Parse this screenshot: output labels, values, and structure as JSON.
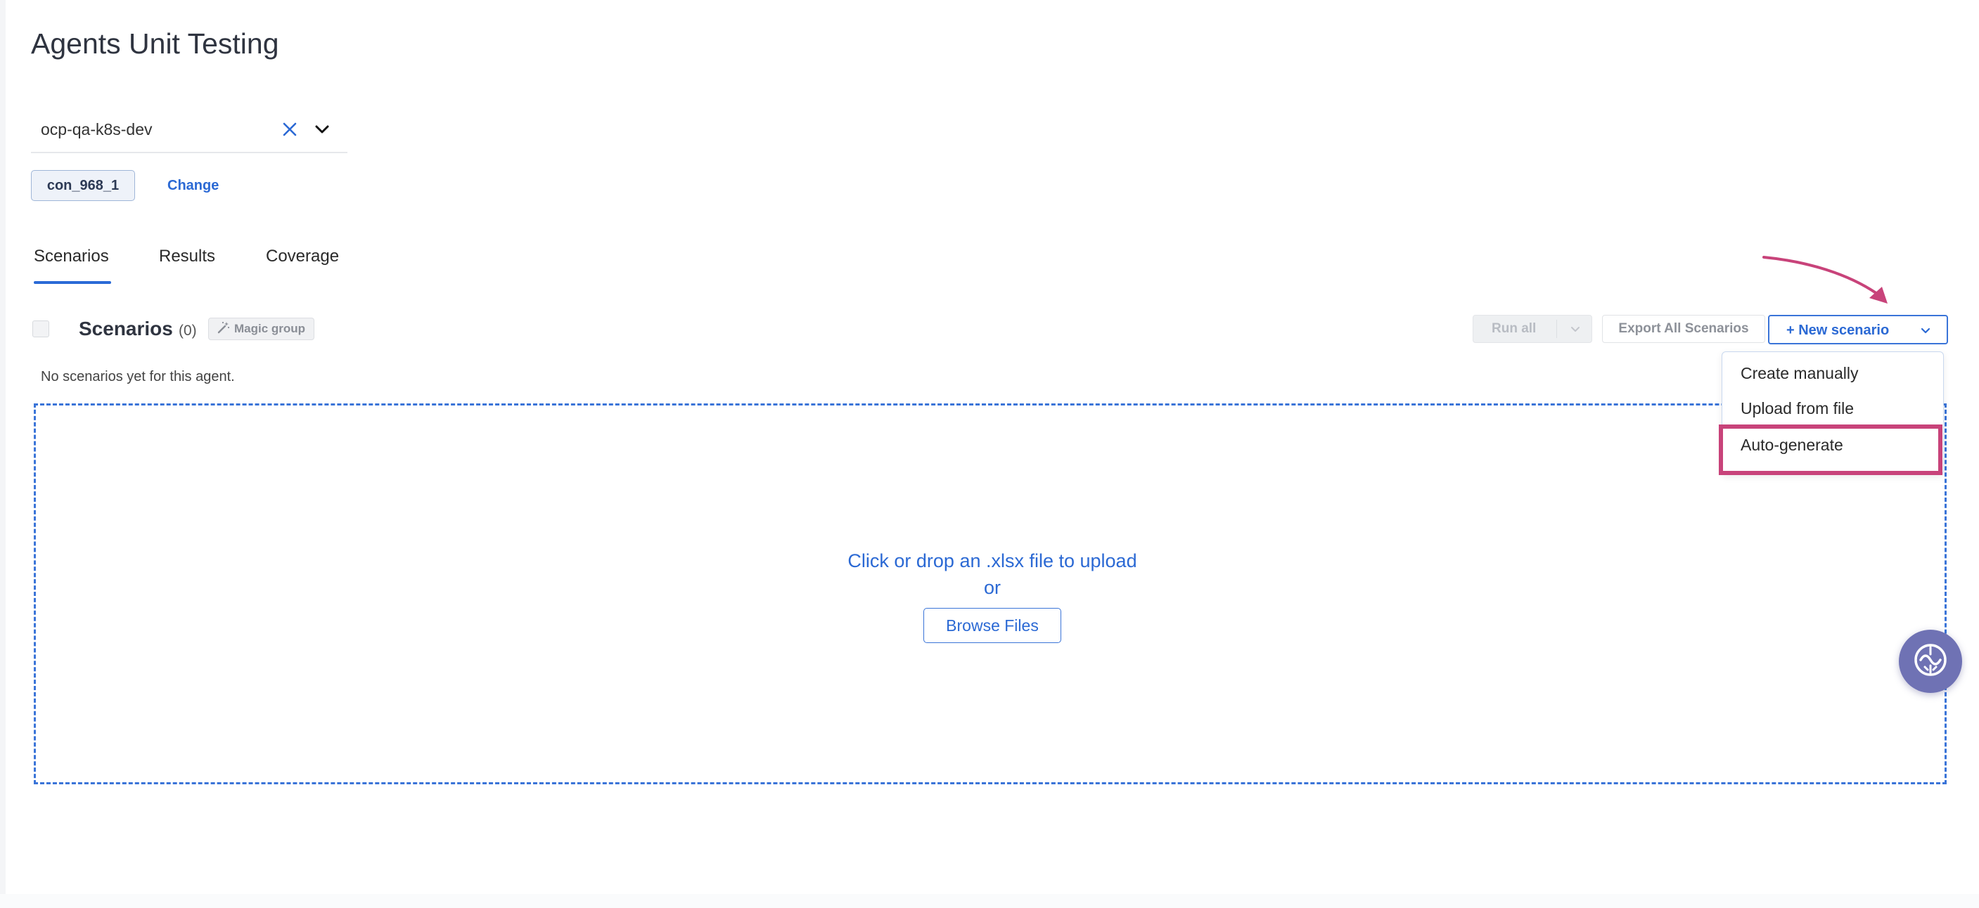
{
  "page": {
    "title": "Agents Unit Testing"
  },
  "project_select": {
    "value": "ocp-qa-k8s-dev"
  },
  "connection": {
    "id": "con_968_1",
    "change_label": "Change"
  },
  "tabs": [
    {
      "label": "Scenarios",
      "active": true
    },
    {
      "label": "Results",
      "active": false
    },
    {
      "label": "Coverage",
      "active": false
    }
  ],
  "scenarios": {
    "heading": "Scenarios",
    "count": "(0)",
    "magic_group_label": "Magic group",
    "empty_message": "No scenarios yet for this agent."
  },
  "toolbar": {
    "run_all_label": "Run all",
    "export_label": "Export All Scenarios",
    "new_scenario_label": "+ New scenario"
  },
  "new_scenario_menu": {
    "items": [
      "Create manually",
      "Upload from file",
      "Auto-generate"
    ],
    "highlighted": "Auto-generate"
  },
  "upload": {
    "prompt": "Click or drop an .xlsx file to upload",
    "or": "or",
    "browse_label": "Browse Files"
  },
  "colors": {
    "accent": "#2b69d4",
    "annotation": "#c8437a",
    "assistant_button": "#6f72b4"
  },
  "icons": {
    "clear": "close-icon",
    "dropdown": "chevron-down-icon",
    "magic": "magic-wand-icon",
    "assistant": "assistant-icon"
  }
}
